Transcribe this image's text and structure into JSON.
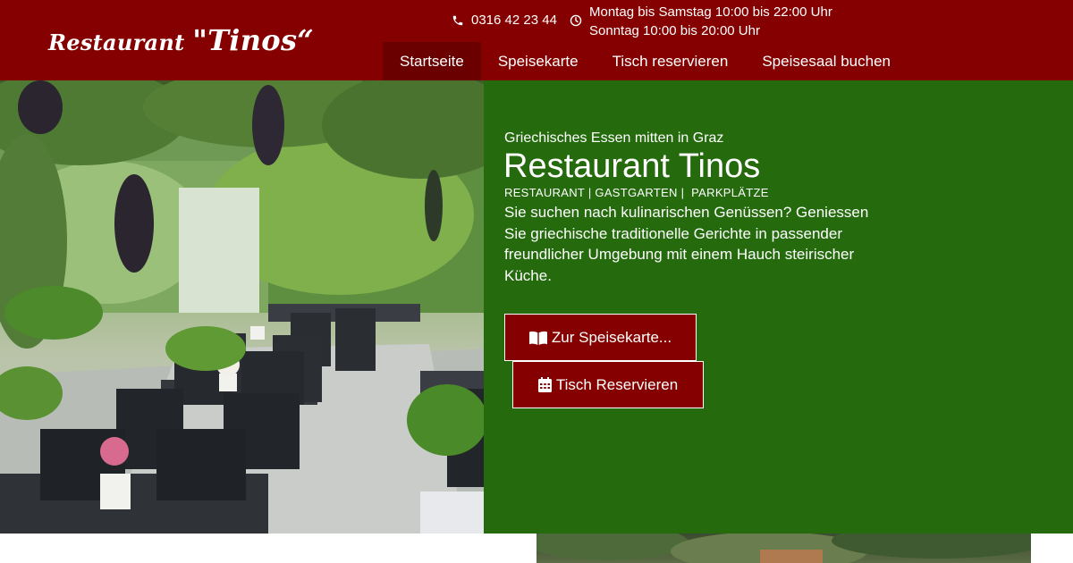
{
  "header": {
    "logo": {
      "part1": "Restaurant ",
      "part2": "\"Tinos“"
    },
    "phone": "0316 42 23 44",
    "hours": [
      "Montag bis Samstag 10:00 bis 22:00 Uhr",
      "Sonntag 10:00 bis 20:00 Uhr"
    ],
    "icons": {
      "phone": "phone-icon",
      "clock": "clock-icon"
    }
  },
  "nav": {
    "items": [
      "Startseite",
      "Speisekarte",
      "Tisch reservieren",
      "Speisesaal buchen"
    ],
    "active": "Startseite"
  },
  "hero": {
    "photo_description_icon": "photo",
    "kicker": "Griechisches Essen mitten in Graz",
    "title": "Restaurant Tinos",
    "tags": "RESTAURANT | GASTGARTEN |  PARKPLÄTZE",
    "description": "Sie suchen nach kulinarischen Genüssen? Geniessen Sie griechische traditionelle Gerichte in passender freundlicher Umgebung mit einem Hauch steirischer Küche.",
    "buttons": {
      "menu": "Zur Speisekarte...",
      "reserve": "Tisch Reservieren"
    },
    "button_icons": {
      "menu": "book-icon",
      "reserve": "calendar-icon"
    }
  },
  "colors": {
    "header_bg": "#850000",
    "nav_active_bg": "#6a0000",
    "panel_bg": "#256b0d",
    "button_bg": "#850000",
    "text": "#ffffff"
  }
}
